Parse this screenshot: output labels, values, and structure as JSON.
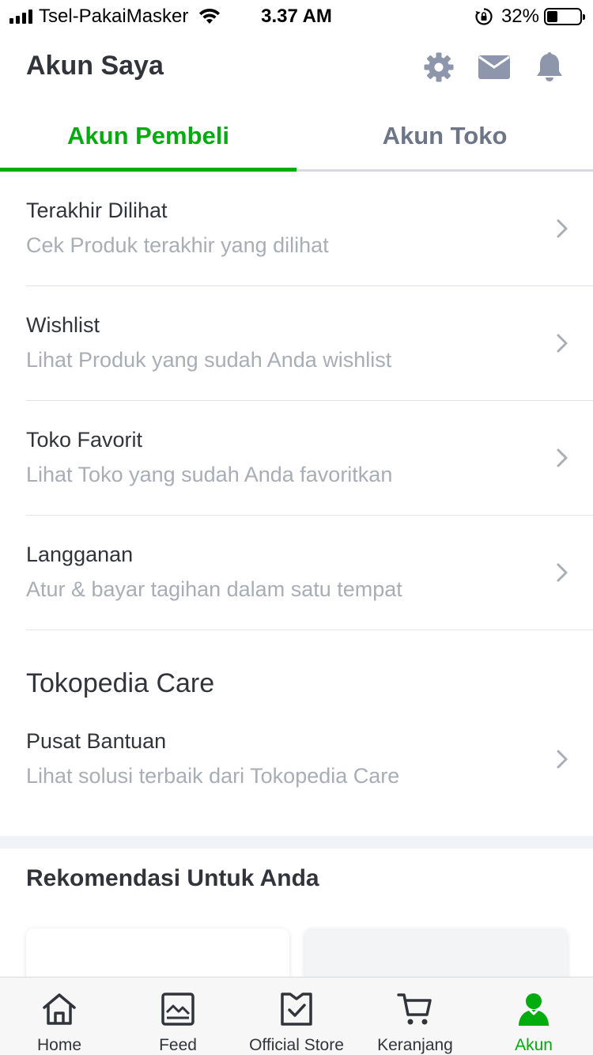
{
  "status_bar": {
    "carrier": "Tsel-PakaiMasker",
    "time": "3.37 AM",
    "battery_percent": "32%",
    "battery_level": 0.32,
    "icons": [
      "signal-icon",
      "wifi-icon",
      "rotation-lock-icon",
      "battery-icon"
    ]
  },
  "header": {
    "title": "Akun Saya",
    "icons": [
      "gear-icon",
      "mail-icon",
      "bell-icon"
    ]
  },
  "tabs": [
    {
      "label": "Akun Pembeli",
      "active": true
    },
    {
      "label": "Akun Toko",
      "active": false
    }
  ],
  "menu": [
    {
      "title": "Terakhir Dilihat",
      "subtitle": "Cek Produk terakhir yang dilihat"
    },
    {
      "title": "Wishlist",
      "subtitle": "Lihat Produk yang sudah Anda wishlist"
    },
    {
      "title": "Toko Favorit",
      "subtitle": "Lihat Toko yang sudah Anda favoritkan"
    },
    {
      "title": "Langganan",
      "subtitle": "Atur & bayar tagihan dalam satu tempat"
    }
  ],
  "care": {
    "section_title": "Tokopedia Care",
    "item": {
      "title": "Pusat Bantuan",
      "subtitle": "Lihat solusi terbaik dari Tokopedia Care"
    }
  },
  "recommendations": {
    "title": "Rekomendasi Untuk Anda"
  },
  "bottom_nav": [
    {
      "label": "Home",
      "icon": "home-icon",
      "active": false
    },
    {
      "label": "Feed",
      "icon": "feed-icon",
      "active": false
    },
    {
      "label": "Official Store",
      "icon": "official-store-icon",
      "active": false
    },
    {
      "label": "Keranjang",
      "icon": "cart-icon",
      "active": false
    },
    {
      "label": "Akun",
      "icon": "account-icon",
      "active": true
    }
  ],
  "colors": {
    "accent": "#03ac0e",
    "text_primary": "#31353b",
    "text_secondary": "#a8adb6",
    "icon_gray": "#8d96aa"
  }
}
